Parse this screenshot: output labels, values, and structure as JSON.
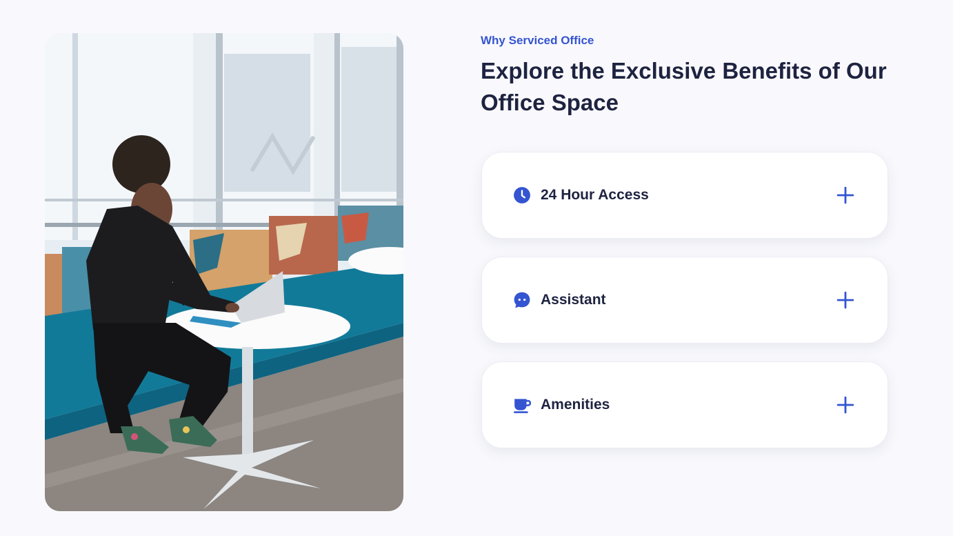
{
  "theme": {
    "accent": "#3454d1",
    "heading": "#1e2340",
    "background": "#f9f9fd"
  },
  "hero_image": {
    "alt": "Woman working on a laptop at a round white table in a bright office lounge"
  },
  "section": {
    "eyebrow": "Why Serviced Office",
    "title": "Explore the Exclusive Benefits of Our Office Space"
  },
  "accordion": {
    "items": [
      {
        "label": "24 Hour Access",
        "icon": "clock-icon",
        "expanded": false
      },
      {
        "label": "Assistant",
        "icon": "chat-bubble-icon",
        "expanded": false
      },
      {
        "label": "Amenities",
        "icon": "coffee-cup-icon",
        "expanded": false
      }
    ]
  }
}
